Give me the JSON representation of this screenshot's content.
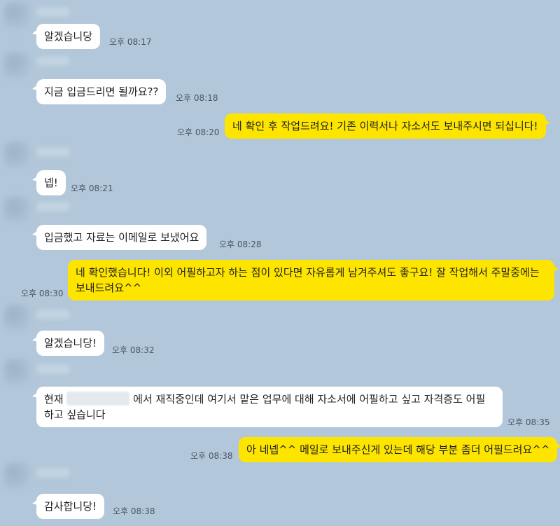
{
  "messages": [
    {
      "text": "알겠습니당",
      "time": "오후 08:17"
    },
    {
      "text": "지금 입금드리면 될까요??",
      "time": "오후 08:18"
    },
    {
      "text": "네 확인 후 작업드려요! 기존 이력서나 자소서도 보내주시면 되십니다!",
      "time": "오후 08:20"
    },
    {
      "text": "넵!",
      "time": "오후 08:21"
    },
    {
      "text": "입금했고 자료는 이메일로 보냈어요",
      "time": "오후 08:28"
    },
    {
      "text": "네 확인했습니다! 이외 어필하고자 하는 점이 있다면 자유롭게 남겨주셔도 좋구요! 잘 작업해서 주말중에는 보내드려요^^",
      "time": "오후 08:30"
    },
    {
      "text": "알겠습니당!",
      "time": "오후 08:32"
    },
    {
      "text_before": "현재",
      "text_after": "에서 재직중인데 여기서 맡은 업무에 대해 자소서에 어필하고 싶고 자격증도 어필하고 싶습니다",
      "time": "오후 08:35"
    },
    {
      "text": "아 네넵^^ 메일로 보내주신게 있는데 해당 부분 좀더 어필드려요^^",
      "time": "오후 08:38"
    },
    {
      "text": "감사합니당!",
      "time": "오후 08:38"
    }
  ]
}
